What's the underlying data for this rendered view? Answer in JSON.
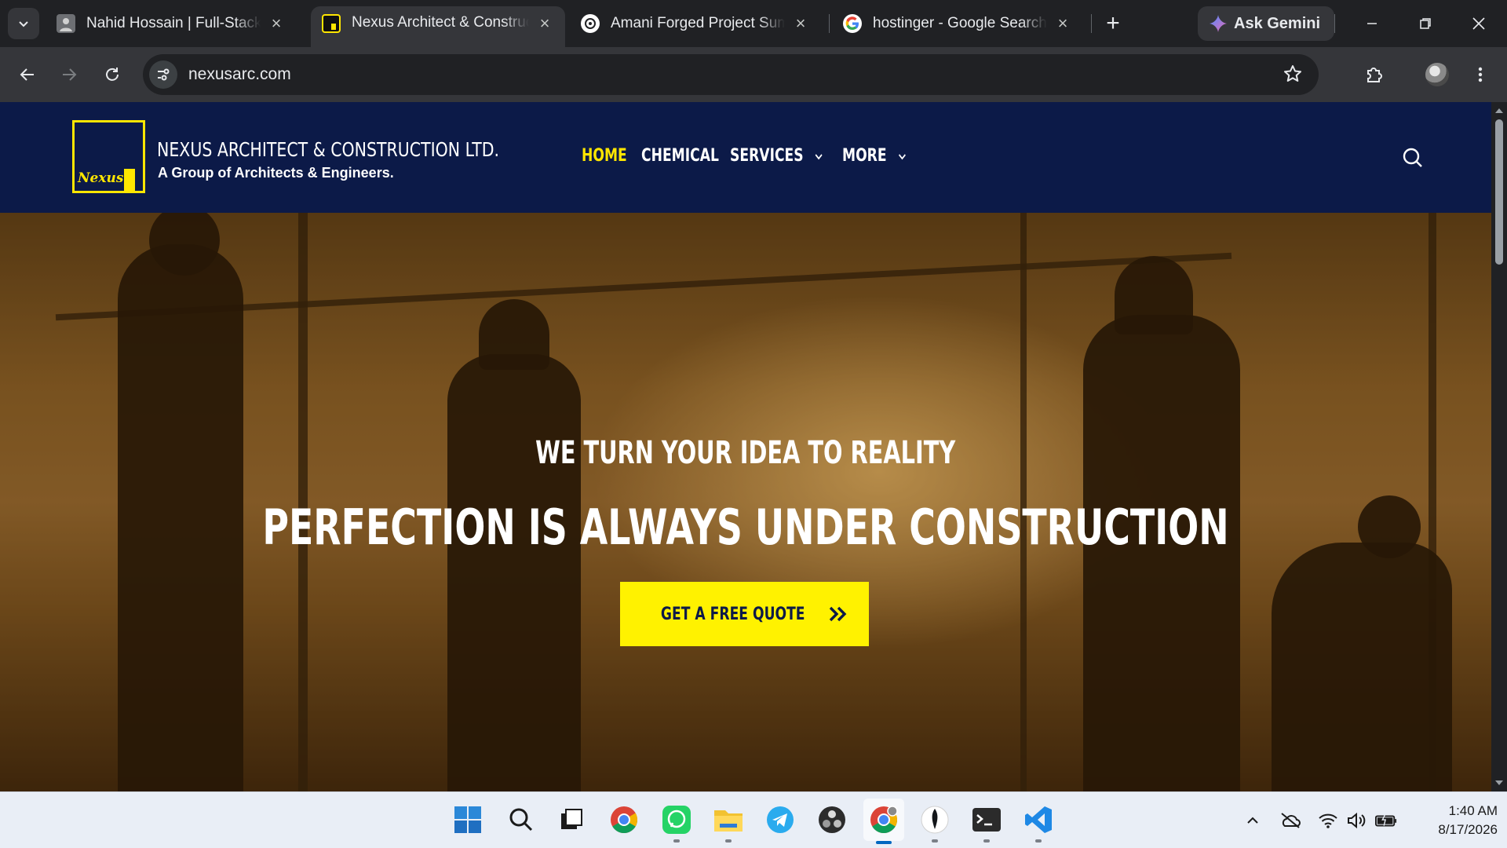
{
  "browser": {
    "tabs": [
      {
        "title": "Nahid Hossain | Full-Stack Developer",
        "favicon": "person-photo-icon",
        "active": false
      },
      {
        "title": "Nexus Architect & Construction Ltd.",
        "favicon": "nexus-logo-icon",
        "active": true
      },
      {
        "title": "Amani Forged Project Summary",
        "favicon": "chatgpt-icon",
        "active": false
      },
      {
        "title": "hostinger - Google Search",
        "favicon": "google-icon",
        "active": false
      }
    ],
    "new_tab_symbol": "+",
    "gemini_label": "Ask Gemini",
    "url": "nexusarc.com",
    "window_controls": {
      "minimize": "—",
      "restore": "❐",
      "close": "✕"
    }
  },
  "site": {
    "brand_name": "NEXUS ARCHITECT & CONSTRUCTION LTD.",
    "brand_tagline": "A Group of  Architects & Engineers.",
    "logo_word": "Nexus",
    "menu": [
      {
        "label": "HOME",
        "active": true,
        "dropdown": false
      },
      {
        "label": "CHEMICAL",
        "active": false,
        "dropdown": false
      },
      {
        "label": "SERVICES",
        "active": false,
        "dropdown": true
      },
      {
        "label": "MORE",
        "active": false,
        "dropdown": true
      }
    ],
    "hero": {
      "subtitle": "WE TURN YOUR IDEA TO REALITY",
      "title": "PERFECTION IS ALWAYS UNDER CONSTRUCTION",
      "cta_label": "GET A FREE QUOTE"
    },
    "colors": {
      "header_bg": "#0c1a48",
      "accent": "#ffe600",
      "cta_bg": "#fff200"
    }
  },
  "taskbar": {
    "apps": [
      "windows-start-icon",
      "search-icon",
      "task-view-icon",
      "chrome-icon",
      "whatsapp-icon",
      "file-explorer-icon",
      "telegram-icon",
      "obs-icon",
      "chrome-profile-icon",
      "mongodb-compass-icon",
      "terminal-icon",
      "vscode-icon"
    ],
    "time": "1:40 AM",
    "date": "8/17/2026"
  }
}
